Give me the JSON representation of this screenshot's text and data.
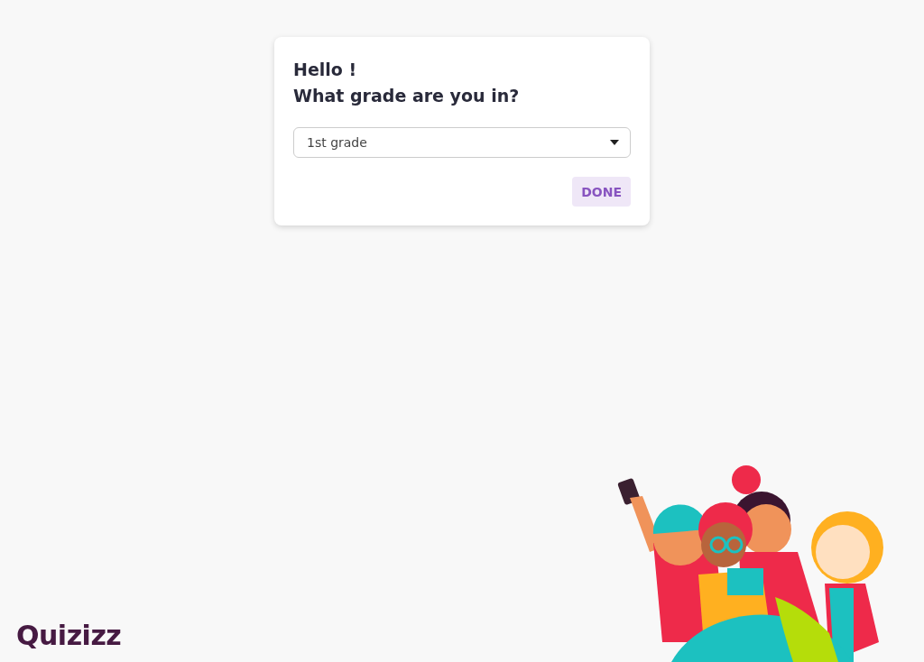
{
  "dialog": {
    "greeting": "Hello !",
    "question": "What grade are you in?",
    "grade_select": {
      "value": "1st grade"
    },
    "done_button": {
      "label": "DONE"
    }
  },
  "logo": {
    "text": "Quizizz"
  }
}
